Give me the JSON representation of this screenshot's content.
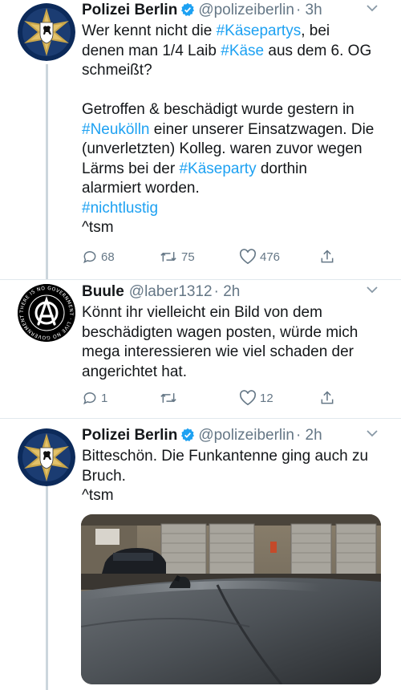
{
  "tweets": [
    {
      "name": "Polizei Berlin",
      "handle": "@polizeiberlin",
      "time": "· 3h",
      "verified": true,
      "lines": [
        [
          {
            "t": "Wer kennt nicht die "
          },
          {
            "t": "#Käsepartys",
            "tag": true
          },
          {
            "t": ", bei"
          }
        ],
        [
          {
            "t": "denen man 1/4 Laib "
          },
          {
            "t": "#Käse",
            "tag": true
          },
          {
            "t": " aus dem 6. OG"
          }
        ],
        [
          {
            "t": "schmeißt?"
          }
        ],
        [],
        [
          {
            "t": "Getroffen & beschädigt wurde gestern in"
          }
        ],
        [
          {
            "t": "#Neukölln",
            "tag": true
          },
          {
            "t": " einer unserer Einsatzwagen. Die"
          }
        ],
        [
          {
            "t": "(unverletzten) Kolleg. waren zuvor wegen"
          }
        ],
        [
          {
            "t": "Lärms bei der "
          },
          {
            "t": "#Käseparty",
            "tag": true
          },
          {
            "t": " dorthin"
          }
        ],
        [
          {
            "t": "alarmiert worden."
          }
        ],
        [
          {
            "t": "#nichtlustig",
            "tag": true
          }
        ],
        [
          {
            "t": "^tsm"
          }
        ]
      ],
      "replies": "68",
      "retweets": "75",
      "likes": "476"
    },
    {
      "name": "Buule",
      "handle": "@laber1312",
      "time": "· 2h",
      "verified": false,
      "lines": [
        [
          {
            "t": "Könnt ihr vielleicht ein Bild von dem"
          }
        ],
        [
          {
            "t": "beschädigten wagen posten, würde mich"
          }
        ],
        [
          {
            "t": "mega interessieren wie viel schaden der"
          }
        ],
        [
          {
            "t": "angerichtet hat."
          }
        ]
      ],
      "replies": "1",
      "retweets": "",
      "likes": "12"
    },
    {
      "name": "Polizei Berlin",
      "handle": "@polizeiberlin",
      "time": "· 2h",
      "verified": true,
      "lines": [
        [
          {
            "t": "Bitteschön. Die Funkantenne ging auch zu"
          }
        ],
        [
          {
            "t": "Bruch."
          }
        ],
        [
          {
            "t": "^tsm"
          }
        ]
      ],
      "replies": "",
      "retweets": "",
      "likes": ""
    }
  ],
  "avatar_text": {
    "ring": "THERE IS NO GOVERNMENT · LIVE NO GOVERNMENT"
  },
  "colors": {
    "link": "#1da1f2",
    "muted": "#657786",
    "police_navy": "#0c2a5a",
    "police_gold": "#c9a64a"
  },
  "icons": [
    "verified-badge-icon",
    "chevron-down-icon",
    "reply-icon",
    "retweet-icon",
    "like-icon",
    "share-icon",
    "berlin-bear-icon",
    "anarchy-icon"
  ]
}
